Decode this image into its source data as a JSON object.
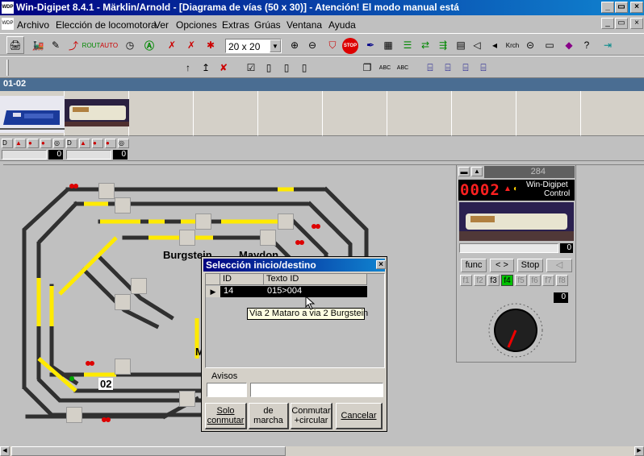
{
  "window": {
    "title": "Win-Digipet 8.4.1 -  Märklin/Arnold - [Diagrama de vías (50 x 30)] - Atención! El modo manual está",
    "minimize_label": "_",
    "maximize_label": "▭",
    "close_label": "×"
  },
  "menu": {
    "items": [
      "Archivo",
      "Elección de locomotora",
      "Ver",
      "Opciones",
      "Extras",
      "Grúas",
      "Ventana",
      "Ayuda"
    ]
  },
  "toolbar": {
    "grid_size_value": "20 x 20",
    "stop_label": "STOP",
    "krch_label": "Krch"
  },
  "locos": {
    "tab_label": "01-02",
    "speed_values": [
      "0",
      "0"
    ]
  },
  "track": {
    "labels": [
      "Burgstein",
      "Maydon",
      "M",
      "02"
    ]
  },
  "dialog": {
    "title": "Selección inicio/destino",
    "columns": [
      "ID",
      "Texto ID"
    ],
    "rows": [
      {
        "id": "14",
        "text": "015>004"
      }
    ],
    "avisos_label": "Avisos",
    "buttons": [
      "Solo conmutar",
      "de marcha",
      "Conmutar +circular",
      "Cancelar"
    ]
  },
  "tooltip": {
    "text": "Via 2 Mataro a via 2 Burgstein"
  },
  "control": {
    "address": "284",
    "digits": "0002",
    "brand_line1": "Win-Digipet",
    "brand_line2": "Control",
    "speed_value": "0",
    "func_label": "func",
    "dir_label": "< >",
    "stop_label": "Stop",
    "fn_keys": [
      "f1",
      "f2",
      "f3",
      "f4",
      "f5",
      "f6",
      "f7",
      "f8"
    ],
    "active_fn": "f4",
    "fn_value": "0",
    "colors": {
      "led_red": "#ff2020",
      "active_green": "#00c000",
      "display_bg": "#000000"
    }
  }
}
